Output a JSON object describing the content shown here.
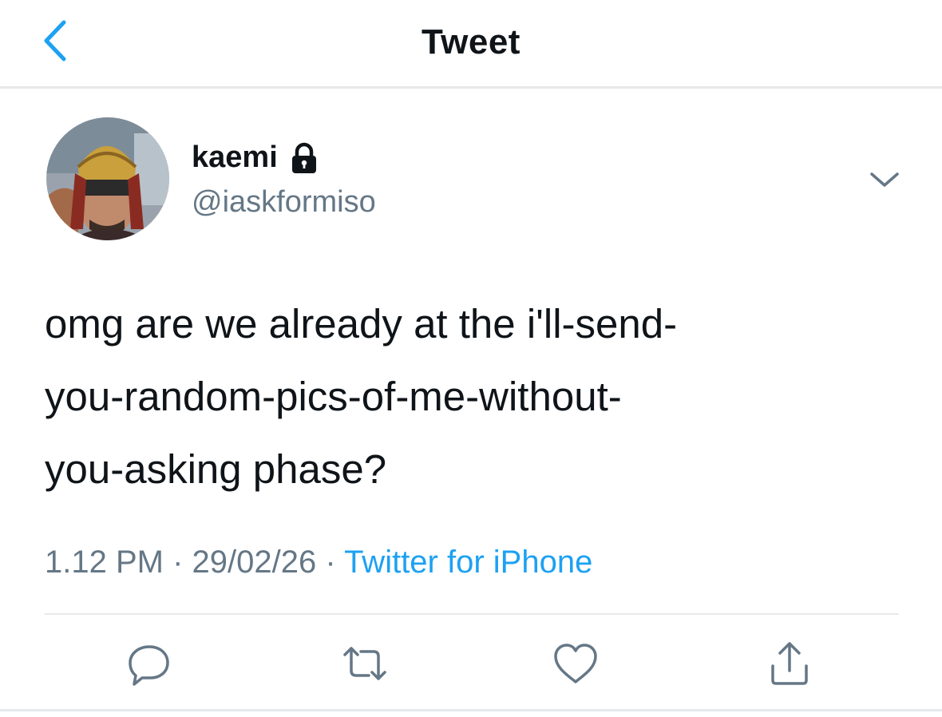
{
  "header": {
    "title": "Tweet",
    "back_icon": "chevron-left-icon"
  },
  "tweet": {
    "author_name": "kaemi",
    "handle": "@iaskformiso",
    "protected_icon": "lock-icon",
    "text_lines": [
      "omg are we already at the i'll-send-",
      "you-random-pics-of-me-without-",
      "you-asking phase?"
    ],
    "time": "1.12 PM",
    "date": "29/02/26",
    "source": "Twitter for iPhone"
  },
  "actions": [
    "reply-icon",
    "retweet-icon",
    "like-icon",
    "share-icon"
  ],
  "colors": {
    "accent": "#1da1f2",
    "secondary_text": "#657786",
    "divider": "#e6e8ea"
  }
}
